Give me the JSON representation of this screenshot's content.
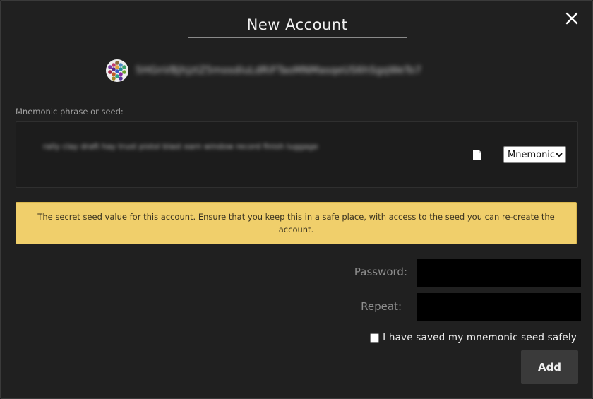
{
  "modal": {
    "title": "New Account",
    "close_icon": "close-icon"
  },
  "account": {
    "identicon_icon": "polkadot-identicon-icon",
    "address": "5HGnVBjhjztZ5mosdiuLdRiFTaoMNMasqeUS6hSgqWeTo7"
  },
  "seed": {
    "label": "Mnemonic phrase or seed:",
    "value": "rally clay draft hay trust pistol blast earn window record finish luggage",
    "copy_icon": "document-copy-icon",
    "type_selected": "Mnemonic"
  },
  "warning": {
    "text": "The secret seed value for this account. Ensure that you keep this in a safe place, with access to the seed you can re-create the account.",
    "color": "#f0cf6b"
  },
  "password": {
    "label": "Password:",
    "value": ""
  },
  "repeat": {
    "label": "Repeat:",
    "value": ""
  },
  "confirm": {
    "label": "I have saved my mnemonic seed safely",
    "checked": false
  },
  "actions": {
    "add_label": "Add"
  }
}
